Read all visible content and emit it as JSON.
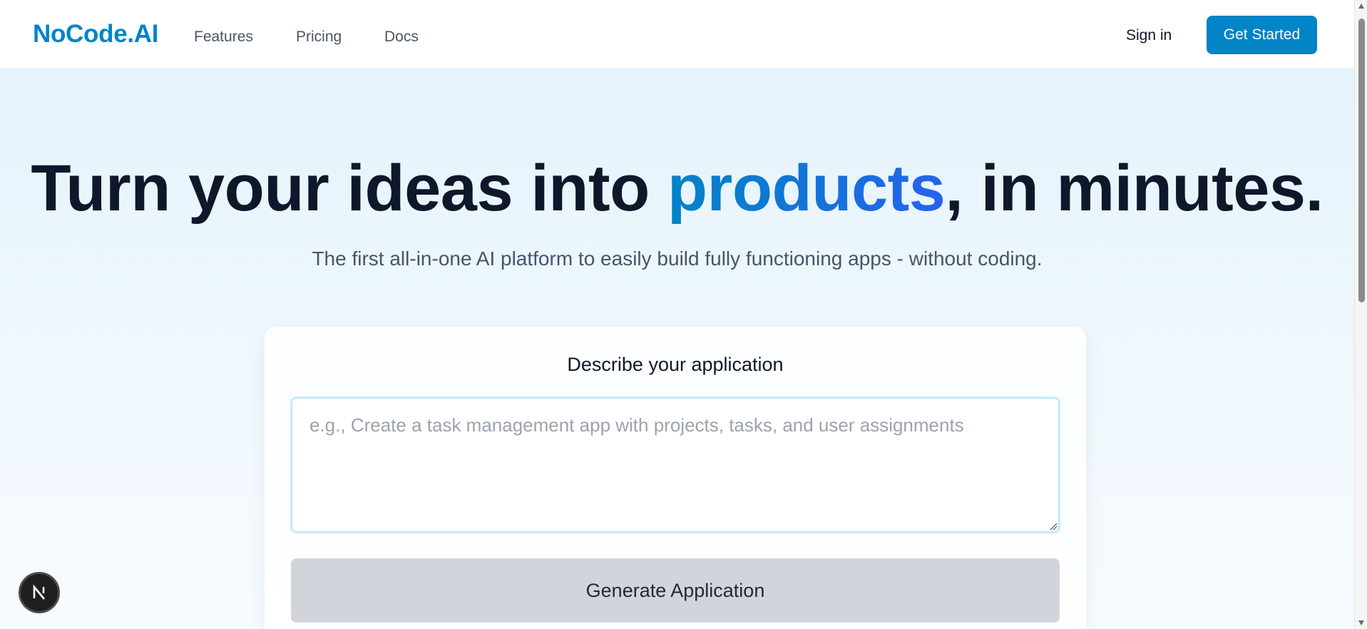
{
  "header": {
    "logo": "NoCode.AI",
    "nav": [
      {
        "label": "Features"
      },
      {
        "label": "Pricing"
      },
      {
        "label": "Docs"
      }
    ],
    "sign_in": "Sign in",
    "get_started": "Get Started"
  },
  "hero": {
    "headline_before": "Turn your ideas into ",
    "headline_accent": "products",
    "headline_after": ", in minutes.",
    "subtitle": "The first all-in-one AI platform to easily build fully functioning apps - without coding."
  },
  "form": {
    "label": "Describe your application",
    "placeholder": "e.g., Create a task management app with projects, tasks, and user assignments",
    "value": "",
    "submit_label": "Generate Application"
  },
  "badge": {
    "letter": "N",
    "icon": "nextjs-icon"
  },
  "colors": {
    "brand": "#0284c7",
    "accent_gradient_end": "#2563eb",
    "heading": "#0f172a",
    "button_disabled": "#d1d5db"
  }
}
